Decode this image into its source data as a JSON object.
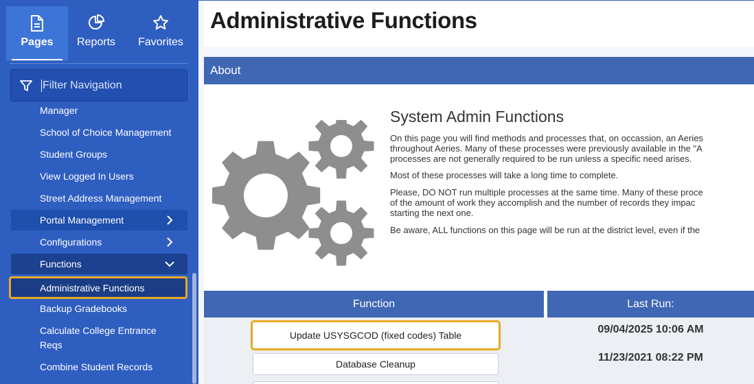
{
  "sidebar": {
    "tabs": [
      {
        "label": "Pages",
        "icon": "document-icon"
      },
      {
        "label": "Reports",
        "icon": "pie-chart-icon"
      },
      {
        "label": "Favorites",
        "icon": "star-icon"
      }
    ],
    "filter": {
      "placeholder": "Filter Navigation",
      "icon": "filter-icon"
    },
    "items": [
      {
        "label": "Manager"
      },
      {
        "label": "School of Choice Management"
      },
      {
        "label": "Student Groups"
      },
      {
        "label": "View Logged In Users"
      },
      {
        "label": "Street Address Management"
      },
      {
        "label": "Portal Management"
      },
      {
        "label": "Configurations"
      },
      {
        "label": "Functions"
      },
      {
        "label": "Administrative Functions"
      },
      {
        "label": "Backup Gradebooks"
      },
      {
        "label": "Calculate College Entrance Reqs"
      },
      {
        "label": "Combine Student Records"
      }
    ]
  },
  "main": {
    "title": "Administrative Functions",
    "about": {
      "header": "About",
      "heading": "System Admin Functions",
      "p1": [
        "On this page you will find methods and processes that, on occassion, an Aeries",
        "throughout Aeries. Many of these processes were previously available in the \"A",
        "processes are not generally required to be run unless a specific need arises."
      ],
      "p2": "Most of these processes will take a long time to complete.",
      "p3": [
        "Please, DO NOT run multiple processes at the same time. Many of these proce",
        "of the amount of work they accomplish and the number of records they impac",
        "starting the next one."
      ],
      "p4": "Be aware, ALL functions on this page will be run at the district level, even if the",
      "icon": "gears-icon"
    },
    "table": {
      "col_function": "Function",
      "col_last_run": "Last Run:",
      "rows": [
        {
          "function": "Update USYSGCOD (fixed codes) Table",
          "last_run": "09/04/2025 10:06 AM"
        },
        {
          "function": "Database Cleanup",
          "last_run": "11/23/2021 08:22 PM"
        }
      ]
    }
  },
  "colors": {
    "sidebar_bg": "#2f5ec1",
    "header_bar": "#3f67b4",
    "highlight": "#e8a923"
  }
}
